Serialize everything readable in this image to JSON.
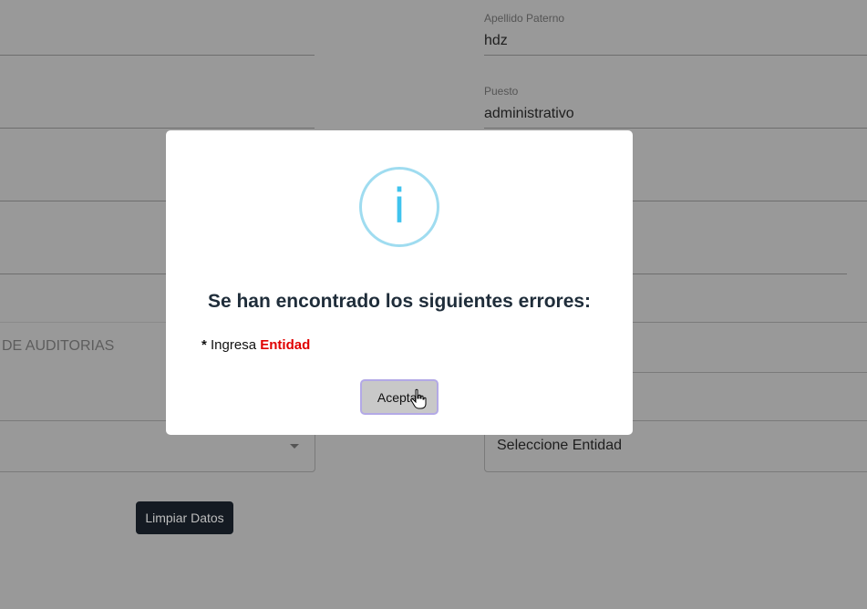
{
  "form": {
    "apellido_paterno_label": "Apellido Paterno",
    "apellido_paterno_value": "hdz",
    "puesto_label": "Puesto",
    "puesto_value": "administrativo",
    "section_text": "DE AUDITORIAS",
    "entidad_select_value": "Seleccione Entidad",
    "clear_button_label": "Limpiar Datos"
  },
  "dialog": {
    "icon": "info-icon",
    "icon_glyph": "i",
    "title": "Se han encontrado los siguientes errores:",
    "error_bullet": "*",
    "error_prefix": "Ingresa",
    "error_field": "Entidad",
    "accept_label": "Aceptar"
  },
  "colors": {
    "overlay": "#999999",
    "info_ring": "#9fdcf0",
    "info_glyph": "#3fc3ee",
    "error_emphasis": "#e00000",
    "accept_border": "#b3a9e6"
  }
}
